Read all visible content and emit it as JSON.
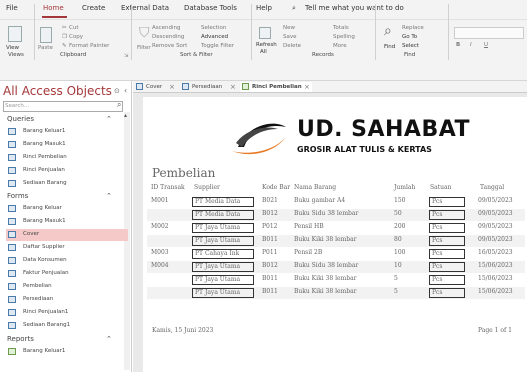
{
  "menu": {
    "file": "File",
    "home": "Home",
    "create": "Create",
    "external": "External Data",
    "dbtools": "Database Tools",
    "help": "Help",
    "tell": "Tell me what you want to do"
  },
  "ribbon": {
    "views_label": "Views",
    "view_btn": "View",
    "clipboard_label": "Clipboard",
    "paste": "Paste",
    "cut": "Cut",
    "copy": "Copy",
    "format_painter": "Format Painter",
    "sort_label": "Sort & Filter",
    "filter": "Filter",
    "ascending": "Ascending",
    "descending": "Descending",
    "remove_sort": "Remove Sort",
    "selection": "Selection",
    "advanced": "Advanced",
    "toggle_filter": "Toggle Filter",
    "records_label": "Records",
    "refresh": "Refresh",
    "all": "All",
    "new": "New",
    "save": "Save",
    "delete": "Delete",
    "totals": "Totals",
    "spelling": "Spelling",
    "more": "More",
    "find_label": "Find",
    "find": "Find",
    "replace": "Replace",
    "goto": "Go To",
    "select": "Select"
  },
  "nav": {
    "title": "All Access Objects",
    "search_placeholder": "Search...",
    "queries_label": "Queries",
    "queries": [
      "Barang Keluar1",
      "Barang Masuk1",
      "Rinci Pembelian",
      "Rinci Penjualan",
      "Sediaan Barang"
    ],
    "forms_label": "Forms",
    "forms": [
      "Barang Keluar",
      "Barang Masuk1",
      "Cover",
      "Daftar Supplier",
      "Data Konsumen",
      "Faktur Penjualan",
      "Pembelian",
      "Persediaan",
      "Rinci Penjualan1",
      "Sediaan Barang1"
    ],
    "reports_label": "Reports",
    "reports": [
      "Barang Keluar1"
    ]
  },
  "tabs": [
    "Cover",
    "Persediaan",
    "Rinci Pembelian"
  ],
  "report": {
    "logo_title": "UD. SAHABAT",
    "logo_sub": "GROSIR ALAT TULIS & KERTAS",
    "title": "Pembelian",
    "headers": [
      "ID Transak",
      "Supplier",
      "Kode Bar",
      "Nama Barang",
      "Jumlah",
      "Satuan",
      "Tanggal"
    ],
    "rows": [
      [
        "M001",
        "PT Media Data",
        "B021",
        "Buku gambar A4",
        "150",
        "Pcs",
        "09/05/2023"
      ],
      [
        "",
        "PT Media Data",
        "B012",
        "Buku Sidu 38 lembar",
        "50",
        "Pcs",
        "09/05/2023"
      ],
      [
        "M002",
        "PT Jaya Utama",
        "P012",
        "Pensil HB",
        "200",
        "Pcs",
        "09/05/2023"
      ],
      [
        "",
        "PT Jaya Utama",
        "B011",
        "Buku Kiki 38 lembar",
        "80",
        "Pcs",
        "09/05/2023"
      ],
      [
        "M003",
        "PT Cahaya Ink",
        "P011",
        "Pensil 2B",
        "100",
        "Pcs",
        "16/05/2023"
      ],
      [
        "M004",
        "PT Jaya Utama",
        "B012",
        "Buku Sidu 38 lembar",
        "10",
        "Pcs",
        "15/06/2023"
      ],
      [
        "",
        "PT Jaya Utama",
        "B011",
        "Buku Kiki 38 lembar",
        "5",
        "Pcs",
        "15/06/2023"
      ],
      [
        "",
        "PT Jaya Utama",
        "B011",
        "Buku Kiki 38 lembar",
        "5",
        "Pcs",
        "15/06/2023"
      ]
    ],
    "footer_date": "Kamis, 15 Juni 2023",
    "footer_page": "Page 1 of 1"
  },
  "colors": {
    "accent": "#a4373a",
    "selected": "#f6c9c9"
  }
}
